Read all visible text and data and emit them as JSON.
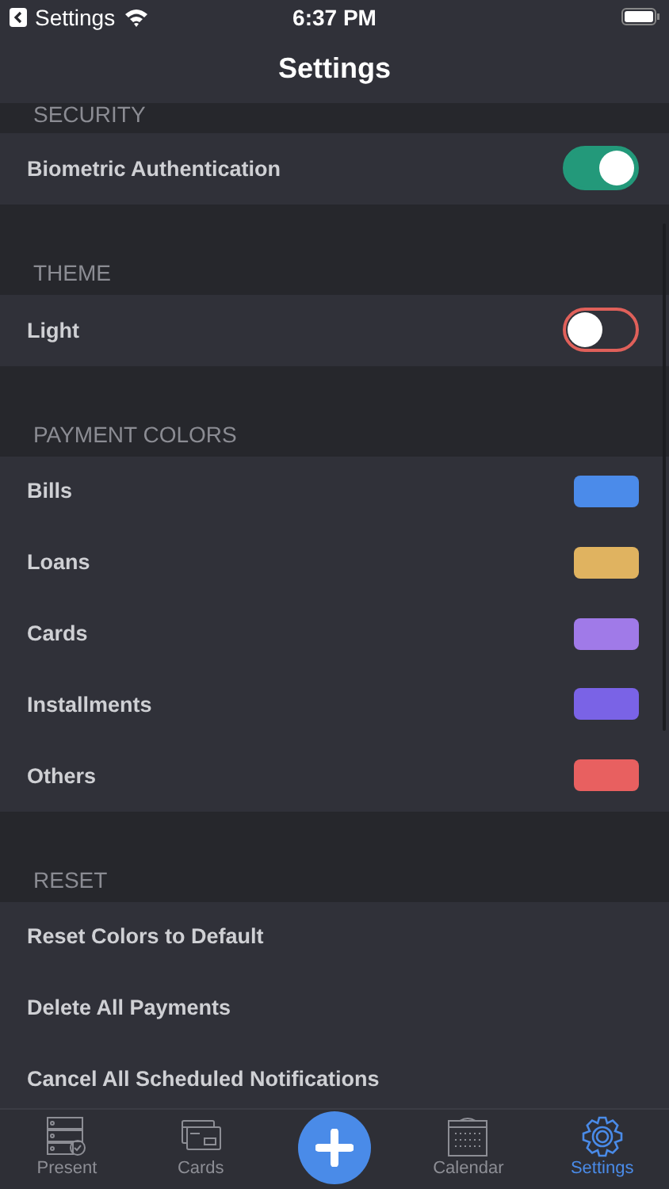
{
  "status_bar": {
    "back_app": "Settings",
    "time": "6:37 PM"
  },
  "nav": {
    "title": "Settings"
  },
  "sections": [
    {
      "title": "SECURITY",
      "rows": [
        {
          "label": "Biometric Authentication",
          "kind": "toggle",
          "on": true
        }
      ]
    },
    {
      "title": "THEME",
      "rows": [
        {
          "label": "Light",
          "kind": "toggle",
          "on": false
        }
      ]
    },
    {
      "title": "PAYMENT COLORS",
      "rows": [
        {
          "label": "Bills",
          "kind": "color",
          "color": "#4b8bea"
        },
        {
          "label": "Loans",
          "kind": "color",
          "color": "#e0b360"
        },
        {
          "label": "Cards",
          "kind": "color",
          "color": "#a07ae8"
        },
        {
          "label": "Installments",
          "kind": "color",
          "color": "#7a63e6"
        },
        {
          "label": "Others",
          "kind": "color",
          "color": "#e86060"
        }
      ]
    },
    {
      "title": "RESET",
      "rows": [
        {
          "label": "Reset Colors to Default",
          "kind": "action"
        },
        {
          "label": "Delete All Payments",
          "kind": "action"
        },
        {
          "label": "Cancel All Scheduled Notifications",
          "kind": "action"
        }
      ]
    }
  ],
  "tabs": [
    {
      "label": "Present",
      "kind": "list",
      "selected": false
    },
    {
      "label": "Cards",
      "kind": "cards",
      "selected": false
    },
    {
      "kind": "add"
    },
    {
      "label": "Calendar",
      "kind": "calendar",
      "selected": false
    },
    {
      "label": "Settings",
      "kind": "gear",
      "selected": true
    }
  ]
}
